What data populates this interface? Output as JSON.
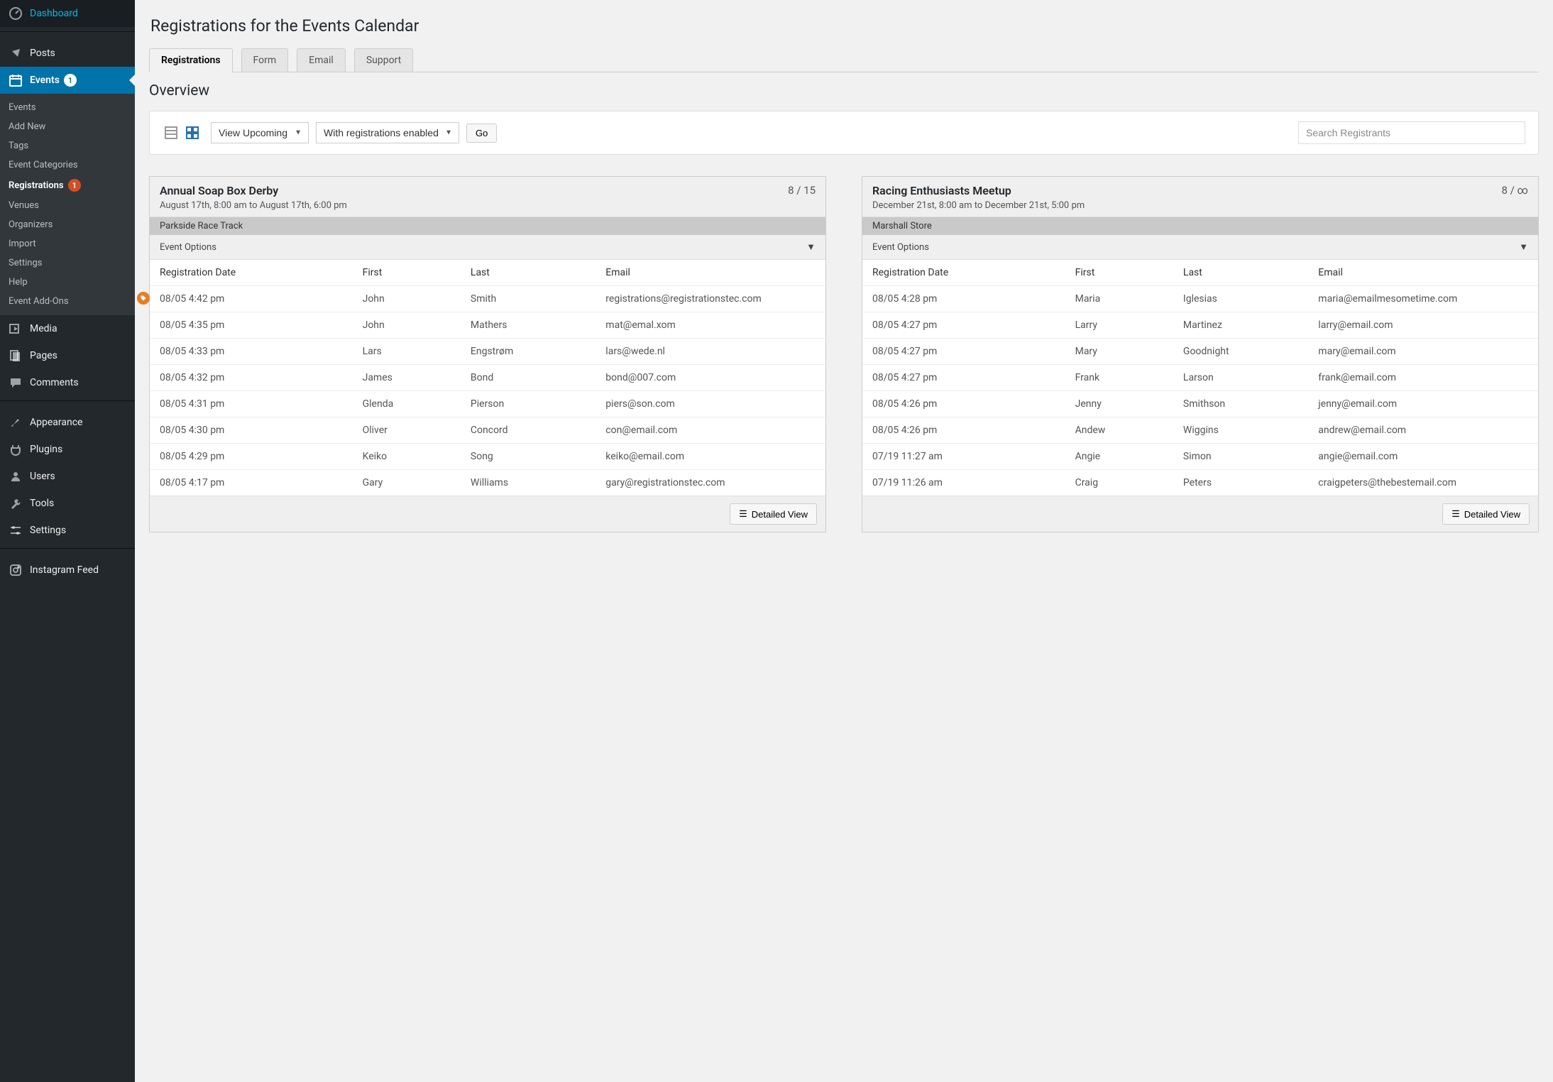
{
  "sidebar": {
    "dashboard": "Dashboard",
    "posts": "Posts",
    "events": "Events",
    "events_badge": "1",
    "submenu": {
      "events": "Events",
      "add_new": "Add New",
      "tags": "Tags",
      "categories": "Event Categories",
      "registrations": "Registrations",
      "registrations_badge": "1",
      "venues": "Venues",
      "organizers": "Organizers",
      "import": "Import",
      "settings": "Settings",
      "help": "Help",
      "addons": "Event Add-Ons"
    },
    "media": "Media",
    "pages": "Pages",
    "comments": "Comments",
    "appearance": "Appearance",
    "plugins": "Plugins",
    "users": "Users",
    "tools": "Tools",
    "settings": "Settings",
    "instagram": "Instagram Feed"
  },
  "page": {
    "title": "Registrations for the Events Calendar",
    "tabs": {
      "registrations": "Registrations",
      "form": "Form",
      "email": "Email",
      "support": "Support"
    },
    "section": "Overview",
    "filter1": "View Upcoming",
    "filter2": "With registrations enabled",
    "go": "Go",
    "search_placeholder": "Search Registrants"
  },
  "cols": {
    "regdate": "Registration Date",
    "first": "First",
    "last": "Last",
    "email": "Email"
  },
  "event_options": "Event Options",
  "detailed_view": "Detailed View",
  "events": [
    {
      "title": "Annual Soap Box Derby",
      "count": "8 / 15",
      "date": "August 17th, 8:00 am to August 17th, 6:00 pm",
      "venue": "Parkside Race Track",
      "rows": [
        {
          "d": "08/05 4:42 pm",
          "f": "John",
          "l": "Smith",
          "e": "registrations@registrationstec.com",
          "marker": true
        },
        {
          "d": "08/05 4:35 pm",
          "f": "John",
          "l": "Mathers",
          "e": "mat@emal.xom"
        },
        {
          "d": "08/05 4:33 pm",
          "f": "Lars",
          "l": "Engstrøm",
          "e": "lars@wede.nl"
        },
        {
          "d": "08/05 4:32 pm",
          "f": "James",
          "l": "Bond",
          "e": "bond@007.com"
        },
        {
          "d": "08/05 4:31 pm",
          "f": "Glenda",
          "l": "Pierson",
          "e": "piers@son.com"
        },
        {
          "d": "08/05 4:30 pm",
          "f": "Oliver",
          "l": "Concord",
          "e": "con@email.com"
        },
        {
          "d": "08/05 4:29 pm",
          "f": "Keiko",
          "l": "Song",
          "e": "keiko@email.com"
        },
        {
          "d": "08/05 4:17 pm",
          "f": "Gary",
          "l": "Williams",
          "e": "gary@registrationstec.com"
        }
      ]
    },
    {
      "title": "Racing Enthusiasts Meetup",
      "count": "8 / ∞",
      "date": "December 21st, 8:00 am to December 21st, 5:00 pm",
      "venue": "Marshall Store",
      "rows": [
        {
          "d": "08/05 4:28 pm",
          "f": "Maria",
          "l": "Iglesias",
          "e": "maria@emailmesometime.com"
        },
        {
          "d": "08/05 4:27 pm",
          "f": "Larry",
          "l": "Martinez",
          "e": "larry@email.com"
        },
        {
          "d": "08/05 4:27 pm",
          "f": "Mary",
          "l": "Goodnight",
          "e": "mary@email.com"
        },
        {
          "d": "08/05 4:27 pm",
          "f": "Frank",
          "l": "Larson",
          "e": "frank@email.com"
        },
        {
          "d": "08/05 4:26 pm",
          "f": "Jenny",
          "l": "Smithson",
          "e": "jenny@email.com"
        },
        {
          "d": "08/05 4:26 pm",
          "f": "Andew",
          "l": "Wiggins",
          "e": "andrew@email.com"
        },
        {
          "d": "07/19 11:27 am",
          "f": "Angie",
          "l": "Simon",
          "e": "angie@email.com"
        },
        {
          "d": "07/19 11:26 am",
          "f": "Craig",
          "l": "Peters",
          "e": "craigpeters@thebestemail.com"
        }
      ]
    }
  ]
}
